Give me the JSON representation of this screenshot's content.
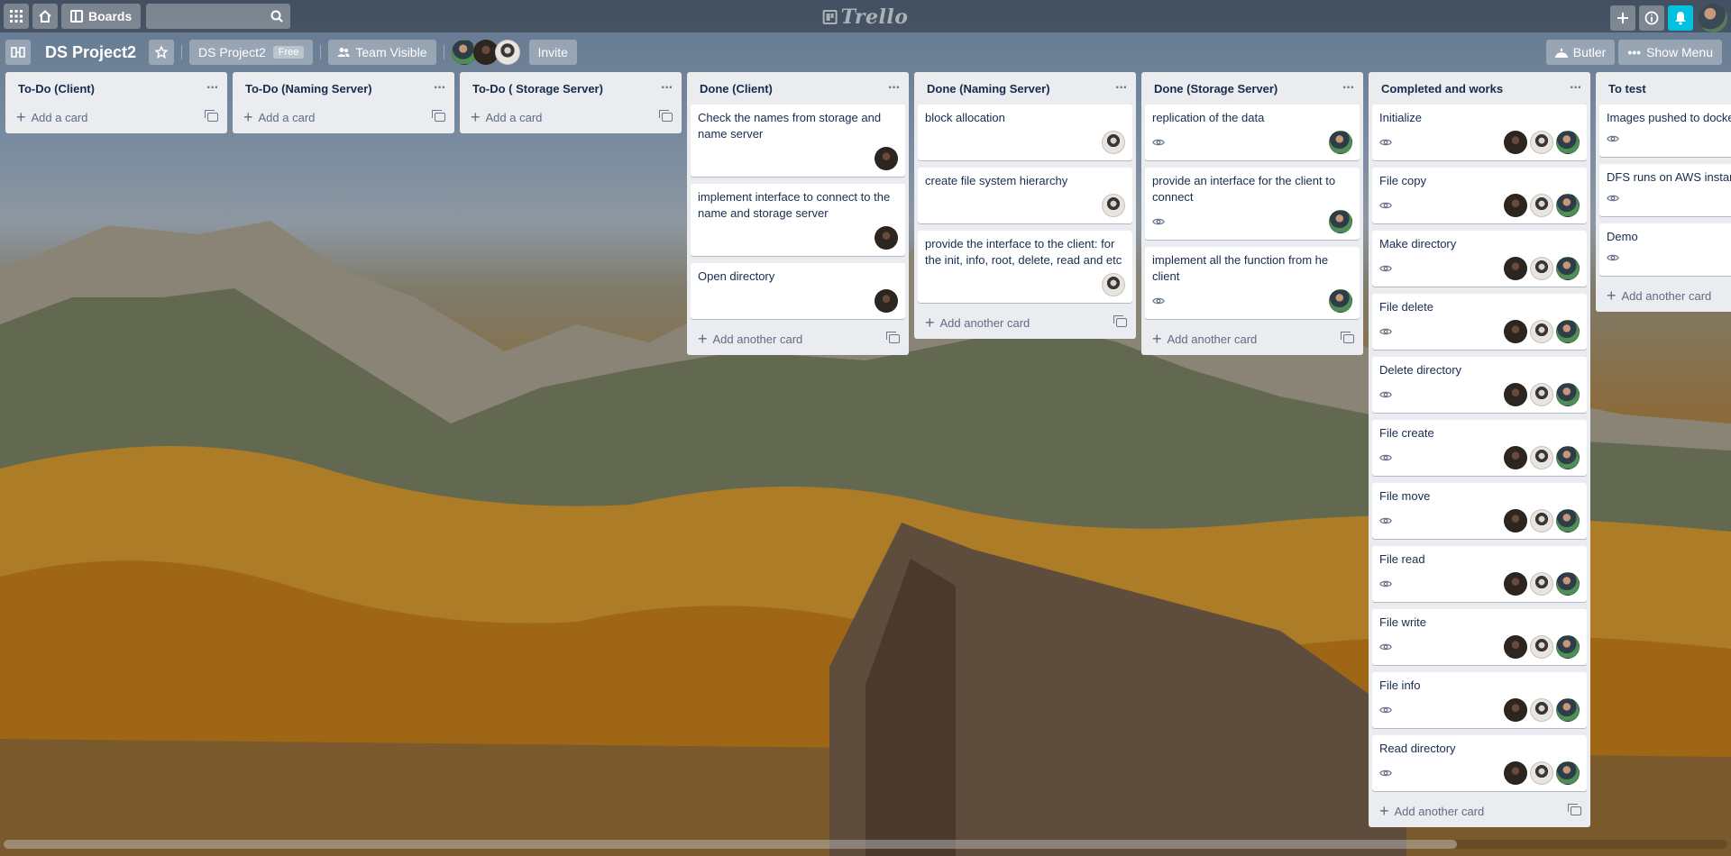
{
  "topbar": {
    "boards_label": "Boards",
    "search_placeholder": "",
    "logo_text": "Trello"
  },
  "board": {
    "title": "DS Project2",
    "team_label": "DS Project2",
    "plan_badge": "Free",
    "visibility_label": "Team Visible",
    "invite_label": "Invite",
    "butler_label": "Butler",
    "show_menu_label": "Show Menu"
  },
  "colors": {
    "notification": "#00c2e0",
    "list_bg": "#ebecf0",
    "text": "#172b4d"
  },
  "lists": [
    {
      "title": "To-Do (Client)",
      "cards": [],
      "add_label": "Add a card"
    },
    {
      "title": "To-Do (Naming Server)",
      "cards": [],
      "add_label": "Add a card"
    },
    {
      "title": "To-Do ( Storage Server)",
      "cards": [],
      "add_label": "Add a card"
    },
    {
      "title": "Done (Client)",
      "cards": [
        {
          "text": "Check the names from storage and name server",
          "watch": false,
          "members": [
            "a"
          ]
        },
        {
          "text": "implement interface to connect to the name and storage server",
          "watch": false,
          "members": [
            "a"
          ]
        },
        {
          "text": "Open directory",
          "watch": false,
          "members": [
            "a"
          ]
        }
      ],
      "add_label": "Add another card"
    },
    {
      "title": "Done (Naming Server)",
      "cards": [
        {
          "text": "block allocation",
          "watch": false,
          "members": [
            "b"
          ]
        },
        {
          "text": "create file system hierarchy",
          "watch": false,
          "members": [
            "b"
          ]
        },
        {
          "text": "provide the interface to the client: for the init, info, root, delete, read and etc",
          "watch": false,
          "members": [
            "b"
          ]
        }
      ],
      "add_label": "Add another card"
    },
    {
      "title": "Done (Storage Server)",
      "cards": [
        {
          "text": "replication of the data",
          "watch": true,
          "members": [
            "c"
          ]
        },
        {
          "text": "provide an interface for the client to connect",
          "watch": true,
          "members": [
            "c"
          ]
        },
        {
          "text": "implement all the function from he client",
          "watch": true,
          "members": [
            "c"
          ]
        }
      ],
      "add_label": "Add another card"
    },
    {
      "title": "Completed and works",
      "cards": [
        {
          "text": "Initialize",
          "watch": true,
          "members": [
            "a",
            "b",
            "c"
          ]
        },
        {
          "text": "File copy",
          "watch": true,
          "members": [
            "a",
            "b",
            "c"
          ]
        },
        {
          "text": "Make directory",
          "watch": true,
          "members": [
            "a",
            "b",
            "c"
          ]
        },
        {
          "text": "File delete",
          "watch": true,
          "members": [
            "a",
            "b",
            "c"
          ]
        },
        {
          "text": "Delete directory",
          "watch": true,
          "members": [
            "a",
            "b",
            "c"
          ]
        },
        {
          "text": "File create",
          "watch": true,
          "members": [
            "a",
            "b",
            "c"
          ]
        },
        {
          "text": "File move",
          "watch": true,
          "members": [
            "a",
            "b",
            "c"
          ]
        },
        {
          "text": "File read",
          "watch": true,
          "members": [
            "a",
            "b",
            "c"
          ]
        },
        {
          "text": "File write",
          "watch": true,
          "members": [
            "a",
            "b",
            "c"
          ]
        },
        {
          "text": "File info",
          "watch": true,
          "members": [
            "a",
            "b",
            "c"
          ]
        },
        {
          "text": "Read directory",
          "watch": true,
          "members": [
            "a",
            "b",
            "c"
          ]
        }
      ],
      "add_label": "Add another card"
    },
    {
      "title": "To test",
      "cards": [
        {
          "text": "Images pushed to docke",
          "watch": true,
          "members": []
        },
        {
          "text": "DFS runs on AWS instan",
          "watch": true,
          "members": []
        },
        {
          "text": "Demo",
          "watch": true,
          "members": []
        }
      ],
      "add_label": "Add another card"
    }
  ]
}
